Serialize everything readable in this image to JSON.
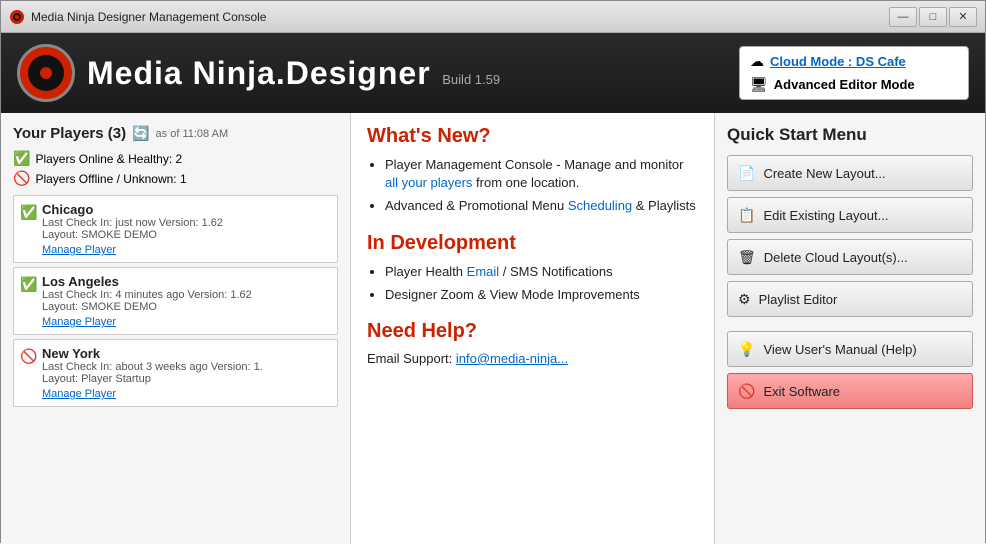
{
  "window": {
    "title": "Media Ninja Designer Management Console"
  },
  "header": {
    "app_title": "Media Ninja.Designer",
    "build": "Build 1.59",
    "cloud_mode_label": "Cloud Mode : DS Cafe",
    "advanced_editor_label": "Advanced Editor Mode"
  },
  "left_panel": {
    "players_title": "Your Players (3)",
    "as_of": "as of 11:08 AM",
    "status_online": "Players Online & Healthy: 2",
    "status_offline": "Players Offline / Unknown: 1",
    "players": [
      {
        "name": "Chicago",
        "check_in": "Last Check In: just now",
        "version": "Version: 1.62",
        "layout": "Layout: SMOKE DEMO",
        "manage_link": "Manage Player",
        "status": "green"
      },
      {
        "name": "Los Angeles",
        "check_in": "Last Check In: 4 minutes ago",
        "version": "Version: 1.62",
        "layout": "Layout: SMOKE DEMO",
        "manage_link": "Manage Player",
        "status": "green"
      },
      {
        "name": "New York",
        "check_in": "Last Check In: about 3 weeks ago",
        "version": "Version: 1.",
        "layout": "Layout: Player Startup",
        "manage_link": "Manage Player",
        "status": "red"
      }
    ]
  },
  "center_panel": {
    "whats_new_title": "What's New?",
    "whats_new_items": [
      "Player Management Console - Manage and monitor all your players from one location.",
      "Advanced & Promotional Menu Scheduling & Playlists"
    ],
    "in_dev_title": "In Development",
    "in_dev_items": [
      "Player Health Email / SMS Notifications",
      "Designer Zoom & View Mode Improvements"
    ],
    "need_help_title": "Need Help?",
    "need_help_text": "Email Support: info@media-ninja..."
  },
  "quick_start": {
    "title": "Quick Start Menu",
    "buttons": [
      {
        "id": "create-layout",
        "icon": "📄",
        "label": "Create New Layout..."
      },
      {
        "id": "edit-layout",
        "icon": "📋",
        "label": "Edit Existing Layout..."
      },
      {
        "id": "delete-layout",
        "icon": "🗑",
        "label": "Delete Cloud Layout(s)..."
      },
      {
        "id": "playlist-editor",
        "icon": "⚙",
        "label": "Playlist Editor"
      },
      {
        "id": "user-manual",
        "icon": "💡",
        "label": "View User's Manual (Help)"
      },
      {
        "id": "exit-software",
        "icon": "🚫",
        "label": "Exit Software"
      }
    ]
  },
  "title_bar_controls": {
    "minimize": "—",
    "maximize": "□",
    "close": "✕"
  }
}
